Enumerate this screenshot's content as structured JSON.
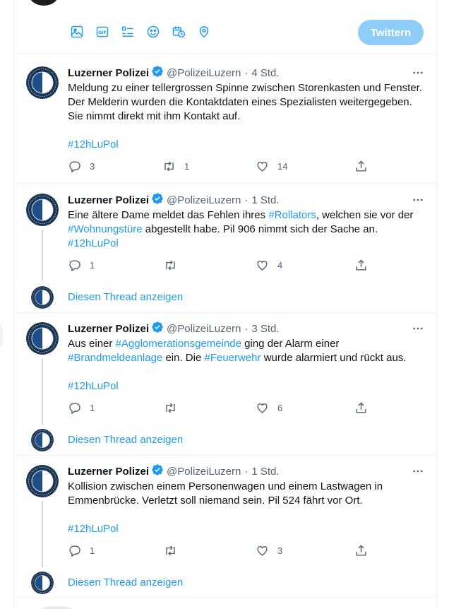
{
  "composer": {
    "tweet_button": "Twittern",
    "tools": [
      "image-icon",
      "gif-icon",
      "poll-icon",
      "emoji-icon",
      "schedule-icon",
      "location-icon"
    ]
  },
  "colors": {
    "accent": "#1d9bf0",
    "accent_disabled": "#8ecdf8",
    "text": "#0f1419",
    "muted": "#536471"
  },
  "tweets": [
    {
      "name": "Luzerner Polizei",
      "handle": "@PolizeiLuzern",
      "time": "4 Std.",
      "lines": [
        [
          {
            "t": "Meldung zu einer tellergrossen Spinne zwischen Storenkasten und Fenster."
          }
        ],
        [
          {
            "t": "Der Melderin wurden die Kontaktdaten eines Spezialisten weitergegeben."
          }
        ],
        [
          {
            "t": "Sie nimmt direkt mit ihm Kontakt auf."
          }
        ],
        [
          {
            "t": ""
          }
        ],
        [
          {
            "t": "#12hLuPol",
            "tag": true
          }
        ]
      ],
      "replies": "3",
      "retweets": "1",
      "likes": "14",
      "show_thread": ""
    },
    {
      "name": "Luzerner Polizei",
      "handle": "@PolizeiLuzern",
      "time": "1 Std.",
      "lines": [
        [
          {
            "t": "Eine ältere Dame meldet das Fehlen ihres "
          },
          {
            "t": "#Rollators",
            "tag": true
          },
          {
            "t": ", welchen sie vor der"
          }
        ],
        [
          {
            "t": "#Wohnungstüre",
            "tag": true
          },
          {
            "t": " abgestellt habe. Pil 906 nimmt sich der Sache an."
          }
        ],
        [
          {
            "t": "#12hLuPol",
            "tag": true
          }
        ]
      ],
      "replies": "1",
      "retweets": "",
      "likes": "4",
      "show_thread": "Diesen Thread anzeigen"
    },
    {
      "name": "Luzerner Polizei",
      "handle": "@PolizeiLuzern",
      "time": "3 Std.",
      "lines": [
        [
          {
            "t": "Aus einer "
          },
          {
            "t": "#Agglomerationsgemeinde",
            "tag": true
          },
          {
            "t": " ging der Alarm einer"
          }
        ],
        [
          {
            "t": "#Brandmeldeanlage",
            "tag": true
          },
          {
            "t": " ein. Die "
          },
          {
            "t": "#Feuerwehr",
            "tag": true
          },
          {
            "t": " wurde alarmiert und rückt aus."
          }
        ],
        [
          {
            "t": ""
          }
        ],
        [
          {
            "t": "#12hLuPol",
            "tag": true
          }
        ]
      ],
      "replies": "1",
      "retweets": "",
      "likes": "6",
      "show_thread": "Diesen Thread anzeigen"
    },
    {
      "name": "Luzerner Polizei",
      "handle": "@PolizeiLuzern",
      "time": "1 Std.",
      "lines": [
        [
          {
            "t": "Kollision zwischen einem Personenwagen und einem Lastwagen in"
          }
        ],
        [
          {
            "t": "Emmenbrücke. Verletzt soll niemand sein. Pil 524 fährt vor Ort."
          }
        ],
        [
          {
            "t": ""
          }
        ],
        [
          {
            "t": "#12hLuPol",
            "tag": true
          }
        ]
      ],
      "replies": "1",
      "retweets": "",
      "likes": "3",
      "show_thread": "Diesen Thread anzeigen"
    }
  ]
}
